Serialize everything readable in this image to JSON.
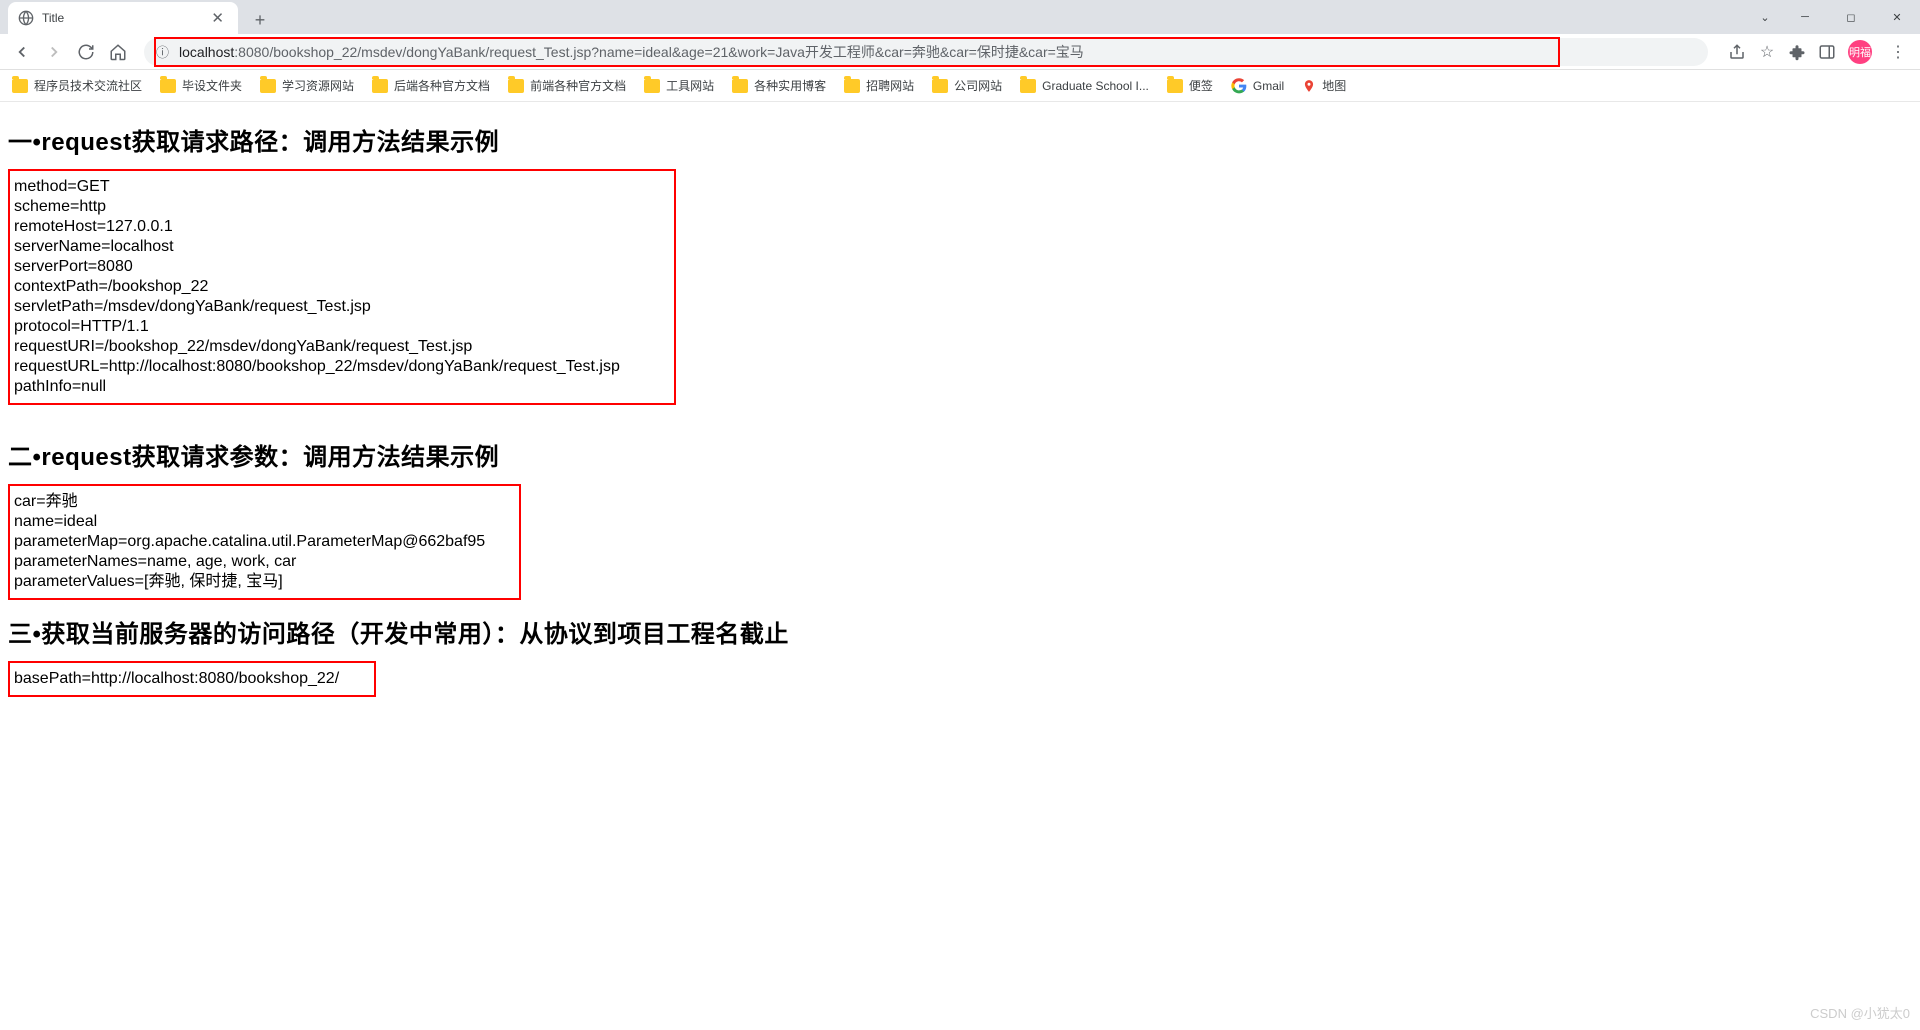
{
  "tab": {
    "title": "Title"
  },
  "url": {
    "domain": "localhost",
    "path": ":8080/bookshop_22/msdev/dongYaBank/request_Test.jsp?name=ideal&age=21&work=Java开发工程师&car=奔驰&car=保时捷&car=宝马"
  },
  "bookmarks": [
    {
      "type": "folder",
      "label": "程序员技术交流社区"
    },
    {
      "type": "folder",
      "label": "毕设文件夹"
    },
    {
      "type": "folder",
      "label": "学习资源网站"
    },
    {
      "type": "folder",
      "label": "后端各种官方文档"
    },
    {
      "type": "folder",
      "label": "前端各种官方文档"
    },
    {
      "type": "folder",
      "label": "工具网站"
    },
    {
      "type": "folder",
      "label": "各种实用博客"
    },
    {
      "type": "folder",
      "label": "招聘网站"
    },
    {
      "type": "folder",
      "label": "公司网站"
    },
    {
      "type": "folder",
      "label": "Graduate School I..."
    },
    {
      "type": "folder",
      "label": "便签"
    },
    {
      "type": "google",
      "label": "Gmail"
    },
    {
      "type": "map",
      "label": "地图"
    }
  ],
  "avatar": "明福",
  "sections": {
    "s1": {
      "title": "一•request获取请求路径：调用方法结果示例",
      "lines": [
        "method=GET",
        "scheme=http",
        "remoteHost=127.0.0.1",
        "serverName=localhost",
        "serverPort=8080",
        "contextPath=/bookshop_22",
        "servletPath=/msdev/dongYaBank/request_Test.jsp",
        "protocol=HTTP/1.1",
        "requestURI=/bookshop_22/msdev/dongYaBank/request_Test.jsp",
        "requestURL=http://localhost:8080/bookshop_22/msdev/dongYaBank/request_Test.jsp",
        "pathInfo=null"
      ]
    },
    "s2": {
      "title": "二•request获取请求参数：调用方法结果示例",
      "lines": [
        "car=奔驰",
        "name=ideal",
        "parameterMap=org.apache.catalina.util.ParameterMap@662baf95",
        "parameterNames=name, age, work, car",
        "parameterValues=[奔驰, 保时捷, 宝马]"
      ]
    },
    "s3": {
      "title": "三•获取当前服务器的访问路径（开发中常用）：从协议到项目工程名截止",
      "lines": [
        "basePath=http://localhost:8080/bookshop_22/"
      ]
    }
  },
  "watermark": "CSDN @小犹太0"
}
